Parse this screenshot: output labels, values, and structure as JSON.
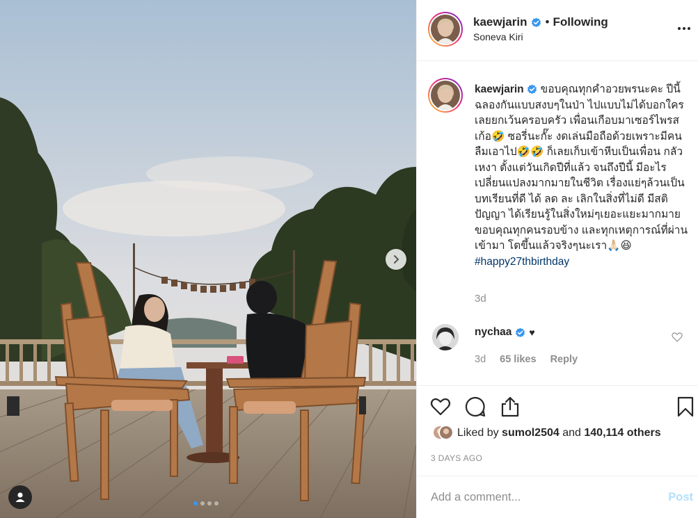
{
  "post": {
    "author": "kaewjarin",
    "follow_label": "Following",
    "separator": "•",
    "location": "Soneva Kiri",
    "caption": "ขอบคุณทุกคำอวยพรนะคะ ปีนี้ฉลองกันแบบสงบๆในป่า ไปแบบไม่ได้บอกใครเลยยกเว้นครอบครัว เพื่อนเกือบมาเซอร์ไพรสเก้อ🤣 ซอรี่นะกั๊ะ งดเล่นมือถือด้วยเพราะมีคนลืมเอาไป🤣🤣 ก็เลยเก็บเข้าหีบเป็นเพื่อน กลัวเหงา ตั้งแต่วันเกิดปีที่แล้ว จนถึงปีนี้ มีอะไรเปลี่ยนแปลงมากมายในชีวิต เรื่องแย่ๆล้วนเป็นบทเรียนที่ดี ได้ ลด ละ เลิกในสิ่งที่ไม่ดี มีสติ ปัญญา ได้เรียนรู้ในสิ่งใหม่ๆเยอะแยะมากมาย ขอบคุณทุกคนรอบข้าง และทุกเหตุการณ์ที่ผ่านเข้ามา โตขึ้นแล้วจริงๆนะเรา🙏🏻😆",
    "hashtag": "#happy27thbirthday",
    "caption_age": "3d"
  },
  "reply": {
    "author": "nychaa",
    "text": "♥",
    "age": "3d",
    "likes": "65 likes",
    "reply_label": "Reply"
  },
  "likes": {
    "prefix": "Liked by",
    "user": "sumol2504",
    "conjunction": "and",
    "others": "140,114 others"
  },
  "date_label": "3 DAYS AGO",
  "composer": {
    "placeholder": "Add a comment...",
    "post_label": "Post"
  },
  "colors": {
    "verified": "#3897f0",
    "hashtag": "#003569",
    "muted": "#8e8e8e",
    "post_disabled": "#b2dffc"
  },
  "icons": [
    "verified-badge-icon",
    "more-options-icon",
    "heart-icon",
    "comment-icon",
    "share-icon",
    "bookmark-icon",
    "chevron-right-icon",
    "user-tag-icon"
  ]
}
